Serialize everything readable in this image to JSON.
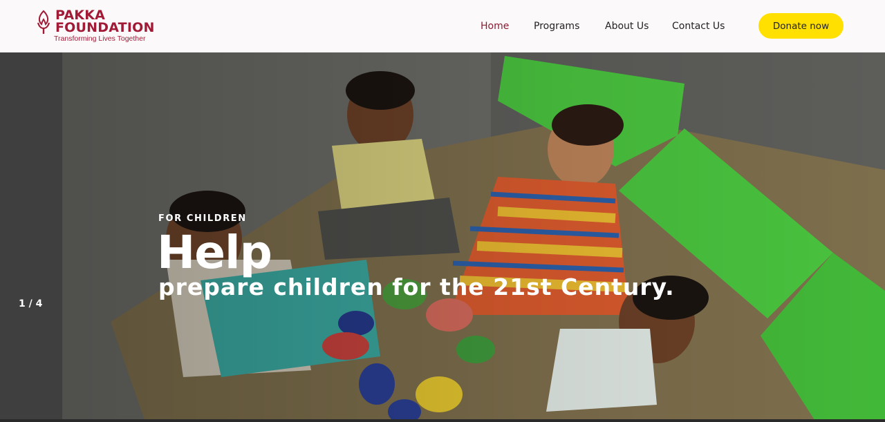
{
  "brand": {
    "name_line1": "PAKKA",
    "name_line2": "FOUNDATION",
    "tagline": "Transforming Lives Together",
    "color": "#a11a36"
  },
  "nav": {
    "items": [
      {
        "label": "Home",
        "active": true
      },
      {
        "label": "Programs",
        "active": false
      },
      {
        "label": "About Us",
        "active": false
      },
      {
        "label": "Contact Us",
        "active": false
      }
    ]
  },
  "donate": {
    "label": "Donate now",
    "color": "#ffe000"
  },
  "hero": {
    "slide_counter": "1 / 4",
    "eyebrow": "FOR CHILDREN",
    "headline": "Help",
    "subline": "prepare children for the 21st Century."
  }
}
